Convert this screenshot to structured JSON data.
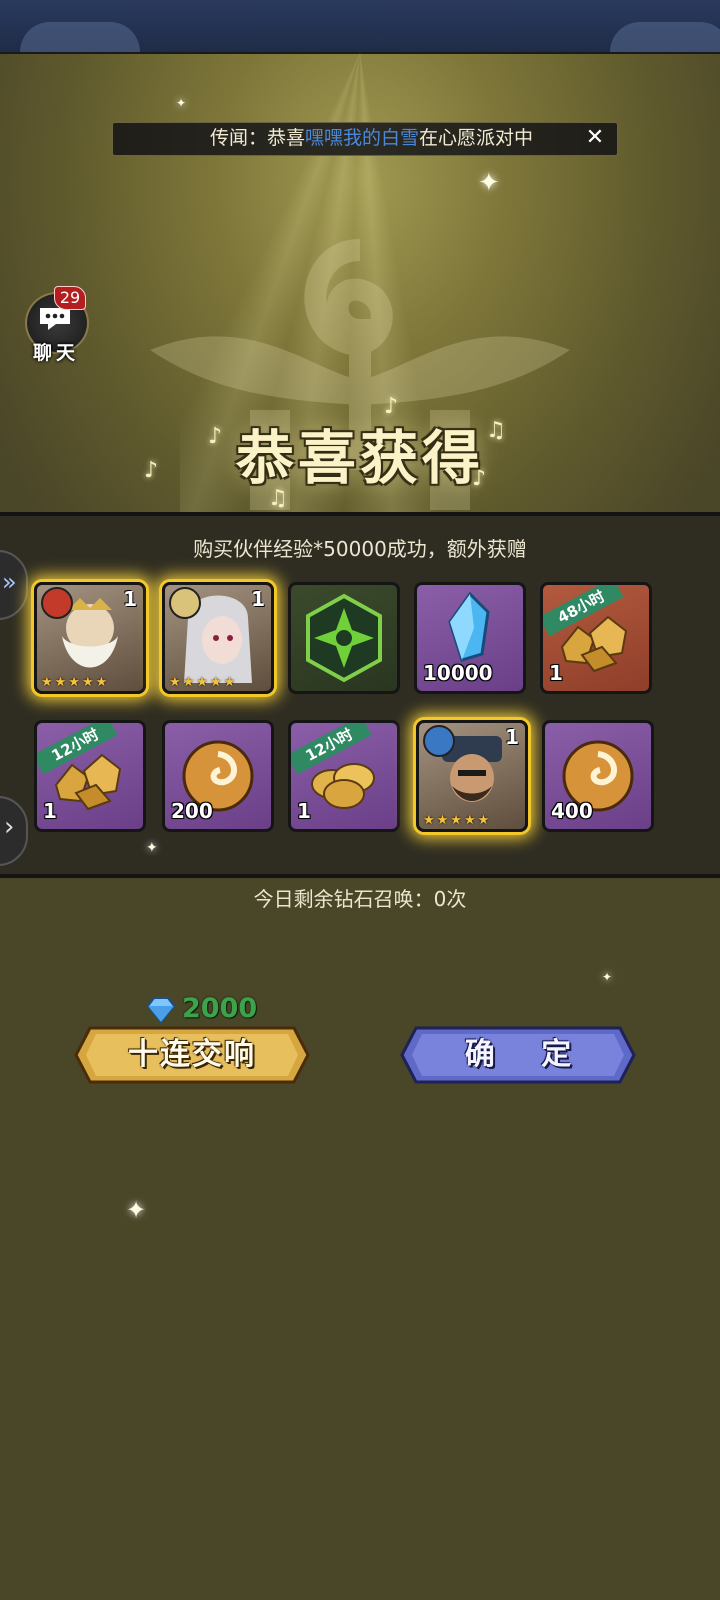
{
  "rumor": {
    "prefix": "传闻：恭喜",
    "player": "嘿嘿我的白雪",
    "suffix": "在心愿派对中",
    "close_icon": "close-icon"
  },
  "chat": {
    "badge": "29",
    "label": "聊天"
  },
  "title": "恭喜获得",
  "reward_message": "购买伙伴经验*50000成功，额外获赠",
  "rewards": [
    {
      "kind": "hero",
      "level": "1",
      "element": "fire",
      "stars": 5,
      "highlight": true
    },
    {
      "kind": "hero",
      "level": "1",
      "element": "light",
      "stars": 5,
      "highlight": true
    },
    {
      "kind": "emblem",
      "icon": "green-emblem-icon"
    },
    {
      "kind": "item",
      "icon": "blue-crystal-icon",
      "quantity": "10000",
      "frame": "purple"
    },
    {
      "kind": "item",
      "icon": "gold-ore-icon",
      "quantity": "1",
      "ribbon": "48小时",
      "frame": "red"
    },
    {
      "kind": "item",
      "icon": "gold-ore-icon",
      "quantity": "1",
      "ribbon": "12小时",
      "frame": "purple"
    },
    {
      "kind": "item",
      "icon": "swirl-orb-icon",
      "quantity": "200",
      "frame": "purple"
    },
    {
      "kind": "item",
      "icon": "gold-coins-icon",
      "quantity": "1",
      "ribbon": "12小时",
      "frame": "purple"
    },
    {
      "kind": "hero",
      "level": "1",
      "element": "water",
      "stars": 5,
      "highlight": true
    },
    {
      "kind": "item",
      "icon": "swirl-orb-icon",
      "quantity": "400",
      "frame": "purple"
    }
  ],
  "remaining_summons": "今日剩余钻石召唤：0次",
  "cost": {
    "icon": "diamond-icon",
    "amount": "2000"
  },
  "buttons": {
    "summon": "十连交响",
    "confirm": "确 定"
  },
  "colors": {
    "summon_button": "#d6a640",
    "confirm_button": "#5f69c7",
    "cost_text": "#3ea24d",
    "highlight_glow": "#f2c72a"
  }
}
